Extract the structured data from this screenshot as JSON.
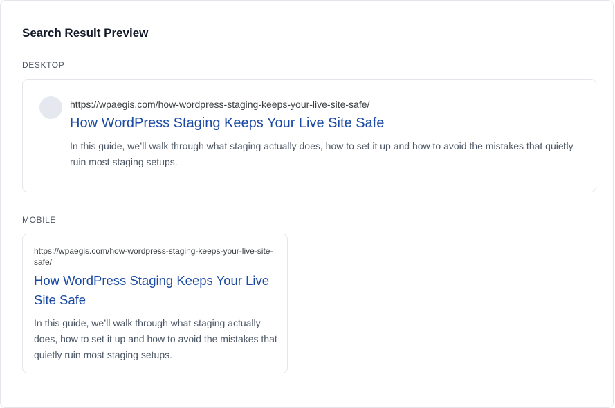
{
  "panel": {
    "title": "Search Result Preview"
  },
  "desktop": {
    "label": "DESKTOP",
    "url": "https://wpaegis.com/how-wordpress-staging-keeps-your-live-site-safe/",
    "headline": "How WordPress Staging Keeps Your Live Site Safe",
    "description": "In this guide, we’ll walk through what staging actually does, how to set it up and how to avoid the mistakes that quietly ruin most staging setups."
  },
  "mobile": {
    "label": "MOBILE",
    "url": "https://wpaegis.com/how-wordpress-staging-keeps-your-live-site-safe/",
    "headline": "How WordPress Staging Keeps Your Live Site Safe",
    "description": "In this guide, we’ll walk through what staging actually does, how to set it up and how to avoid the mistakes that quietly ruin most staging setups."
  },
  "colors": {
    "link": "#1a4aa3",
    "text": "#4b5563",
    "border": "#e3e6ea",
    "favicon_placeholder": "#e5e9ef"
  }
}
